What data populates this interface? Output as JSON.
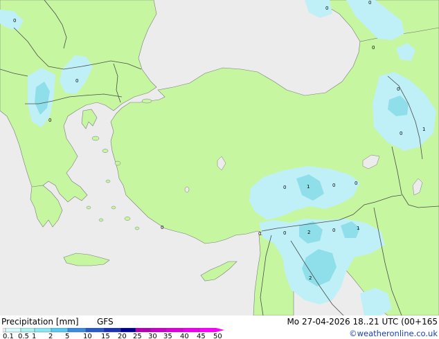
{
  "footer": {
    "title": "Precipitation [mm]",
    "model": "GFS",
    "datetime": "Mo 27-04-2026 18..21 UTC (00+165",
    "credit": "©weatheronline.co.uk"
  },
  "scale": {
    "ticks": [
      "0.1",
      "0.5",
      "1",
      "2",
      "5",
      "10",
      "15",
      "20",
      "25",
      "30",
      "35",
      "40",
      "45",
      "50"
    ],
    "colors": [
      "#f5f5f5",
      "#d2fafa",
      "#aaf0f0",
      "#8ce6f0",
      "#5ac8f0",
      "#3c8cdc",
      "#285ac8",
      "#1e32b4",
      "#000096",
      "#b400b4",
      "#c800c8",
      "#dc00dc",
      "#f000f0",
      "#ff00ff"
    ]
  },
  "map": {
    "colors": {
      "sea": "#ececec",
      "land": "#c6f7a0",
      "precip_light": "#bff0f7",
      "precip_medium": "#8fdfea",
      "border": "#4a4a4a"
    },
    "value_labels": [
      "0",
      "0",
      "0",
      "0",
      "0",
      "0",
      "0",
      "0",
      "0",
      "1",
      "0",
      "0",
      "0",
      "0",
      "1",
      "0",
      "2",
      "0",
      "1",
      "2"
    ]
  }
}
